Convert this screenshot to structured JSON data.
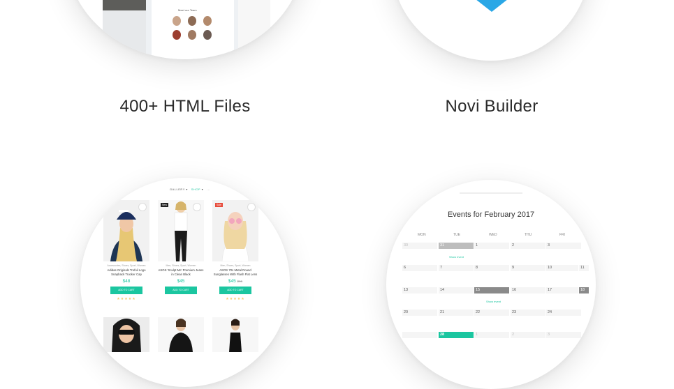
{
  "features": {
    "html_files": {
      "title": "400+ HTML Files",
      "preview": {
        "heading": "Meet our Team"
      }
    },
    "novi_builder": {
      "title": "Novi Builder",
      "logo_color": "#2aa7e6"
    },
    "shop": {
      "nav": {
        "item1": "GALLERY",
        "item2": "SHOP",
        "item3": "..."
      },
      "products": [
        {
          "cat": "Accessories, Shoes, Sport, Women",
          "name": "Adidas Originals Trefoil Logo Snapback Trucker Cap",
          "price": "$48",
          "old": "",
          "btn": "ADD TO CART",
          "tag": "",
          "tag_color": ""
        },
        {
          "cat": "Men, Shoes, Sport, Women",
          "name": "ASOS 'Sculpt Me' Premium Jeans in Clean Black",
          "price": "$45",
          "old": "",
          "btn": "ADD TO CART",
          "tag": "New",
          "tag_color": "#222"
        },
        {
          "cat": "Men, Shoes, Sport, Women",
          "name": "ASOS 70s Metal Round Sunglasses With Flash Flat Lens",
          "price": "$45",
          "old": "$56",
          "btn": "ADD TO CART",
          "tag": "Sale",
          "tag_color": "#e74c3c"
        }
      ],
      "accent": "#1bc6a0",
      "stars": "★★★★★"
    },
    "calendar": {
      "title": "Events for February  2017",
      "days": [
        "MON",
        "TUE",
        "WED",
        "THU",
        "FRI"
      ],
      "weeks": [
        [
          "30",
          "31",
          "1",
          "2",
          "3"
        ],
        [
          "6",
          "7",
          "8",
          "9",
          "10",
          "11"
        ],
        [
          "13",
          "14",
          "15",
          "16",
          "17",
          "18"
        ],
        [
          "20",
          "21",
          "22",
          "23",
          "24"
        ],
        [
          "",
          "28",
          "1",
          "2",
          "3"
        ]
      ],
      "show_event": "Show event",
      "accent": "#1bc6a0"
    }
  }
}
